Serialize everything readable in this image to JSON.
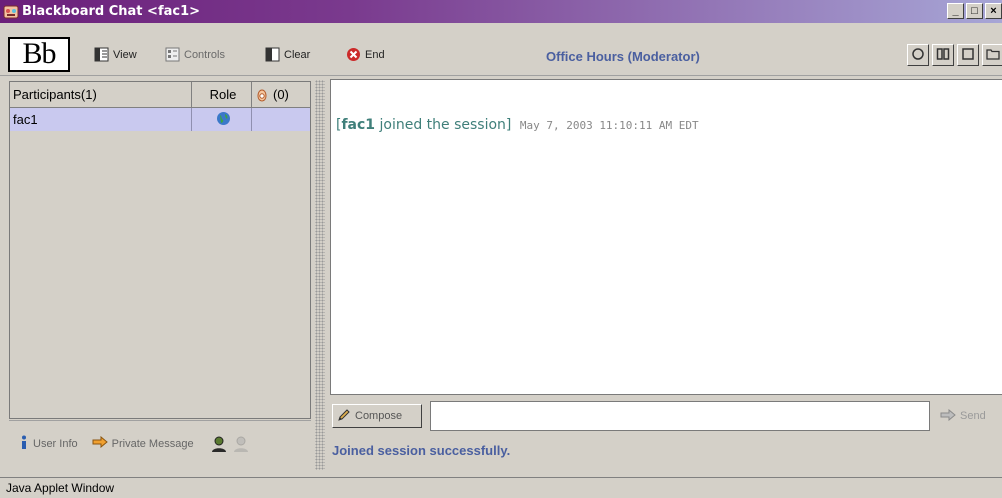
{
  "window": {
    "title": "Blackboard Chat <fac1>",
    "controls": [
      "_",
      "□",
      "×"
    ]
  },
  "toolbar": {
    "logo": "Bb",
    "view_label": "View",
    "controls_label": "Controls",
    "clear_label": "Clear",
    "end_label": "End",
    "session_title": "Office Hours (Moderator)",
    "layout_buttons": [
      "circle-layout-icon",
      "two-pane-layout-icon",
      "single-pane-layout-icon",
      "folder-icon"
    ]
  },
  "participants": {
    "header_name": "Participants(1)",
    "header_role": "Role",
    "header_hand": "(0)",
    "rows": [
      {
        "name": "fac1",
        "role_icon": "globe-icon",
        "hand": ""
      }
    ]
  },
  "left_bottom": {
    "user_info_label": "User Info",
    "private_message_label": "Private Message"
  },
  "chat": {
    "messages": [
      {
        "prefix": "[",
        "user": "fac1",
        "text": " joined the session]",
        "timestamp": "May 7, 2003 11:10:11 AM EDT"
      }
    ]
  },
  "compose": {
    "button_label": "Compose",
    "input_value": "",
    "send_label": "Send"
  },
  "status": {
    "message": "Joined session successfully."
  },
  "footer": {
    "text": "Java Applet Window"
  },
  "colors": {
    "title_gradient_start": "#6b1f7a",
    "accent_text": "#4a5fa0",
    "chat_text": "#3f7f7a",
    "selected_row": "#c9c9ef"
  }
}
